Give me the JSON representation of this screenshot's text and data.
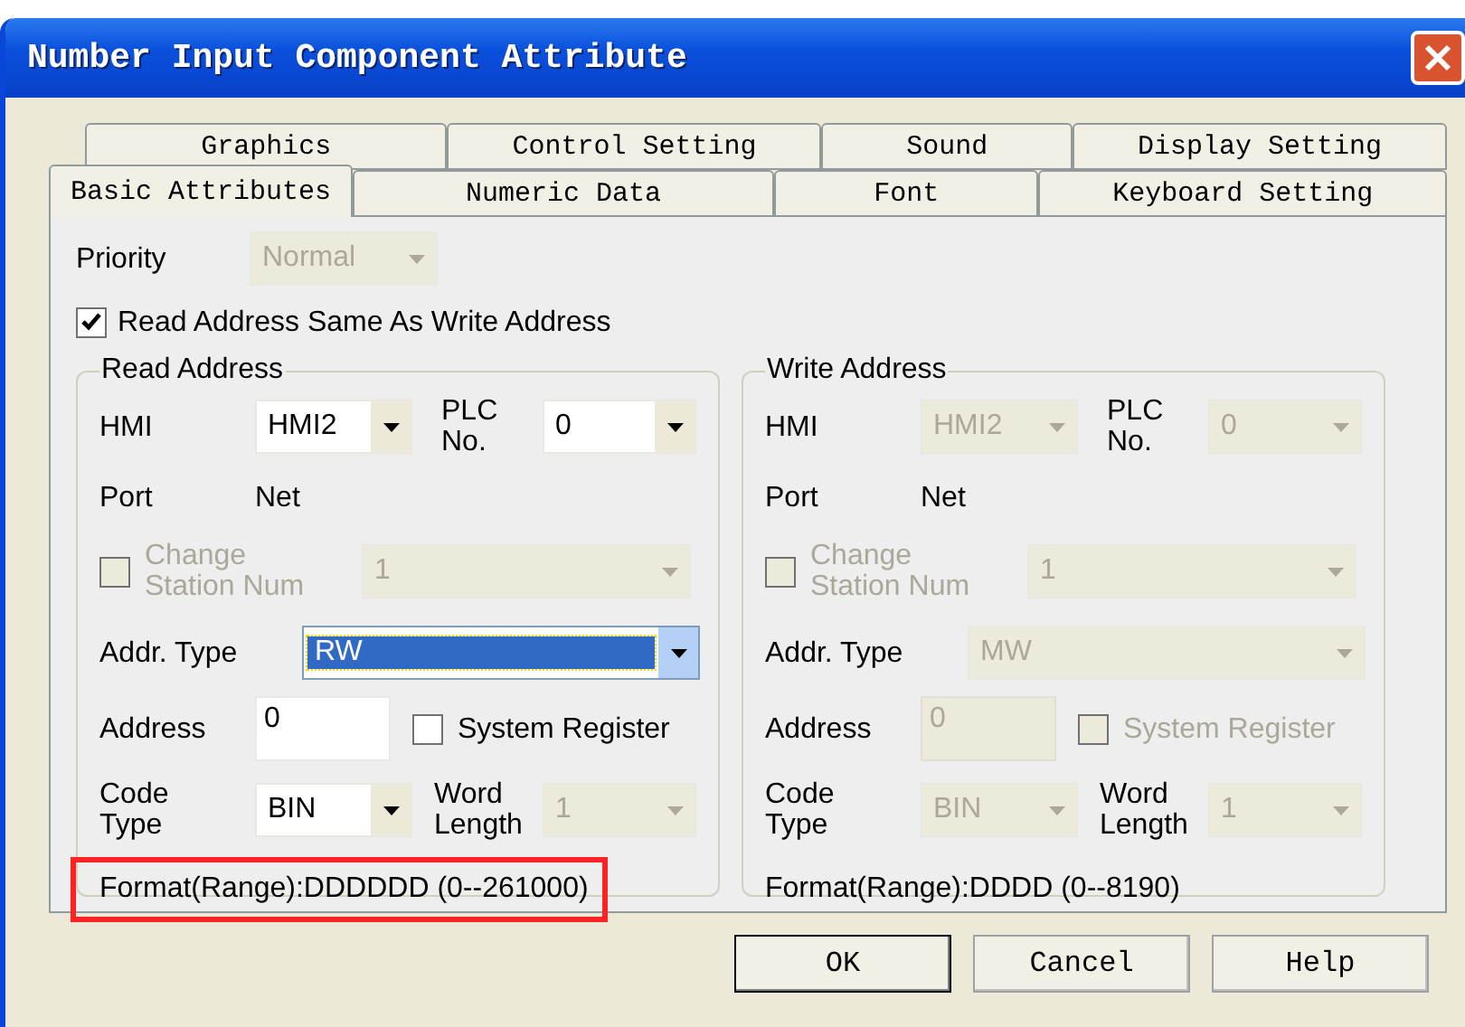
{
  "window": {
    "title": "Number Input Component Attribute"
  },
  "tab_rows": [
    [
      {
        "label": "Graphics",
        "selected": false
      },
      {
        "label": "Control Setting",
        "selected": false
      },
      {
        "label": "Sound",
        "selected": false
      },
      {
        "label": "Display Setting",
        "selected": false
      }
    ],
    [
      {
        "label": "Basic Attributes",
        "selected": true
      },
      {
        "label": "Numeric Data",
        "selected": false
      },
      {
        "label": "Font",
        "selected": false
      },
      {
        "label": "Keyboard Setting",
        "selected": false
      }
    ]
  ],
  "priority": {
    "label": "Priority",
    "value": "Normal",
    "disabled": true
  },
  "same_address": {
    "label": "Read Address Same As Write Address",
    "checked": true
  },
  "groups": [
    {
      "title": "Read Address",
      "hmi": {
        "label": "HMI",
        "value": "HMI2",
        "disabled": false
      },
      "plc": {
        "label": "PLC No.",
        "value": "0",
        "disabled": false
      },
      "port": {
        "label": "Port",
        "value": "Net"
      },
      "station": {
        "label": "Change Station Num",
        "checked": false,
        "disabled": true,
        "value": "1"
      },
      "addr_type": {
        "label": "Addr. Type",
        "value": "RW",
        "disabled": false,
        "focused": true
      },
      "address": {
        "label": "Address",
        "value": "0",
        "disabled": false
      },
      "system_register": {
        "label": "System Register",
        "checked": false,
        "disabled": false
      },
      "code_type": {
        "label": "Code Type",
        "value": "BIN",
        "disabled": false
      },
      "word_length": {
        "label": "Word Length",
        "value": "1",
        "disabled": true
      },
      "format": {
        "text": "Format(Range):DDDDDD (0--261000)",
        "highlighted": true
      }
    },
    {
      "title": "Write Address",
      "hmi": {
        "label": "HMI",
        "value": "HMI2",
        "disabled": true
      },
      "plc": {
        "label": "PLC No.",
        "value": "0",
        "disabled": true
      },
      "port": {
        "label": "Port",
        "value": "Net"
      },
      "station": {
        "label": "Change Station Num",
        "checked": false,
        "disabled": true,
        "value": "1"
      },
      "addr_type": {
        "label": "Addr. Type",
        "value": "MW",
        "disabled": true,
        "focused": false
      },
      "address": {
        "label": "Address",
        "value": "0",
        "disabled": true
      },
      "system_register": {
        "label": "System Register",
        "checked": false,
        "disabled": true
      },
      "code_type": {
        "label": "Code Type",
        "value": "BIN",
        "disabled": true
      },
      "word_length": {
        "label": "Word Length",
        "value": "1",
        "disabled": true
      },
      "format": {
        "text": "Format(Range):DDDD (0--8190)",
        "highlighted": false
      }
    }
  ],
  "buttons": [
    {
      "label": "OK",
      "default": true
    },
    {
      "label": "Cancel",
      "default": false
    },
    {
      "label": "Help",
      "default": false
    }
  ]
}
